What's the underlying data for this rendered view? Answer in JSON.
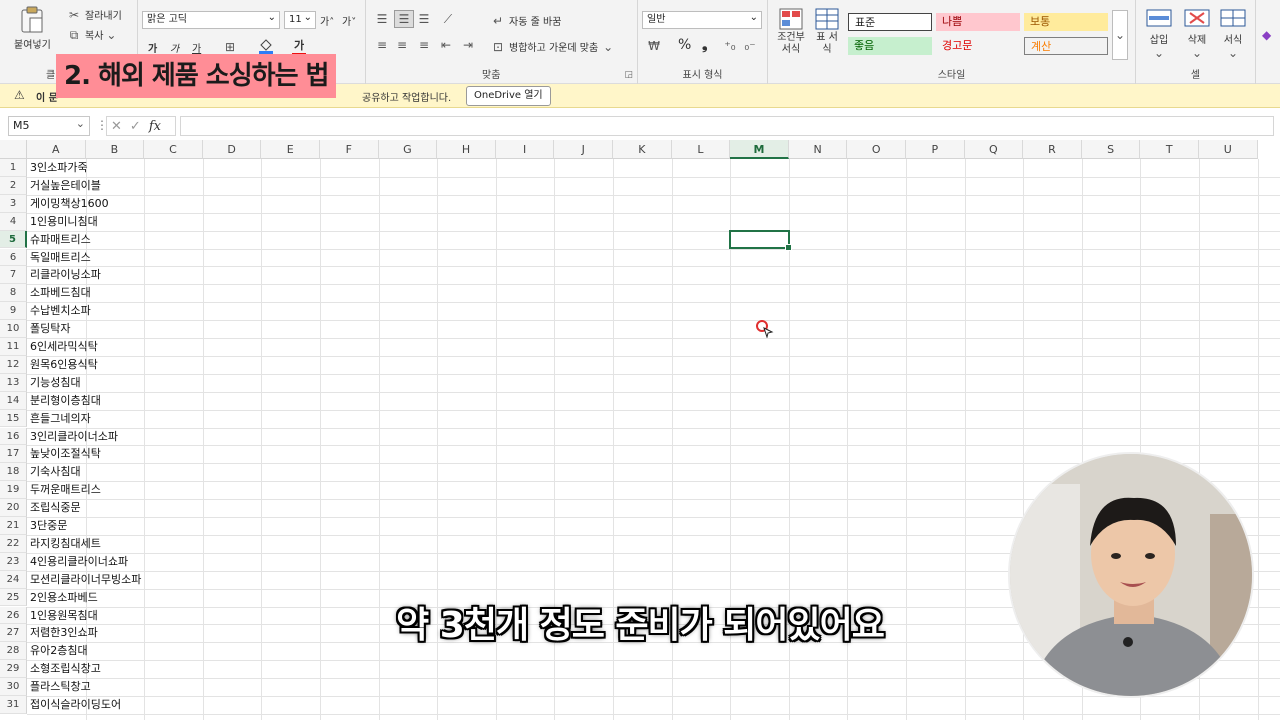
{
  "ribbon": {
    "clipboard": {
      "paste": "붙여넣기",
      "cut": "잘라내기",
      "copy": "복사",
      "group_label": "클"
    },
    "font": {
      "name": "맑은 고딕",
      "size": "11",
      "grow": "가˄",
      "shrink": "가˅",
      "bold": "가",
      "italic": "가",
      "underline": "가",
      "color_letter": "가"
    },
    "alignment": {
      "wrap": "자동 줄 바꿈",
      "merge": "병합하고 가운데 맞춤",
      "group_label": "맞춤"
    },
    "number": {
      "format": "일반",
      "percent": "%",
      "comma": "❟",
      "group_label": "표시 형식"
    },
    "styles": {
      "cond_format": "조건부 서식",
      "table_format": "표 서식",
      "cells": [
        "표준",
        "나쁨",
        "보통",
        "좋음",
        "경고문",
        "계산"
      ],
      "group_label": "스타일"
    },
    "cells": {
      "insert": "삽입",
      "delete": "삭제",
      "format": "서식",
      "group_label": "셀"
    }
  },
  "infobar": {
    "prefix": "이 문",
    "tail": "공유하고 작업합니다.",
    "button": "OneDrive 열기"
  },
  "title_overlay": "2. 해외 제품 소싱하는 법",
  "formula_bar": {
    "namebox": "M5",
    "fx": "fx",
    "value": ""
  },
  "grid": {
    "columns": [
      "A",
      "B",
      "C",
      "D",
      "E",
      "F",
      "G",
      "H",
      "I",
      "J",
      "K",
      "L",
      "M",
      "N",
      "O",
      "P",
      "Q",
      "R",
      "S",
      "T",
      "U"
    ],
    "selected_column": "M",
    "selected_row": 5,
    "rows": [
      "3인소파가죽",
      "거실높은테이블",
      "게이밍책상1600",
      "1인용미니침대",
      "슈파매트리스",
      "독일매트리스",
      "리클라이닝소파",
      "소파베드침대",
      "수납벤치소파",
      "폴딩탁자",
      "6인세라믹식탁",
      "원목6인용식탁",
      "기능성침대",
      "분리형이층침대",
      "흔들그네의자",
      "3인리클라이너소파",
      "높낮이조절식탁",
      "기숙사침대",
      "두꺼운매트리스",
      "조립식중문",
      "3단중문",
      "라지킹침대세트",
      "4인용리클라이너쇼파",
      "모션리클라이너무빙소파",
      "2인용소파베드",
      "1인용원목침대",
      "저렴한3인쇼파",
      "유아2층침대",
      "소형조립식창고",
      "플라스틱창고",
      "접이식슬라이딩도어"
    ]
  },
  "subtitle": "약 3천개 정도 준비가 되어있어요",
  "colors": {
    "excel_green": "#217346",
    "title_bg": "#ff8d96",
    "infobar_bg": "#fff6c9"
  }
}
